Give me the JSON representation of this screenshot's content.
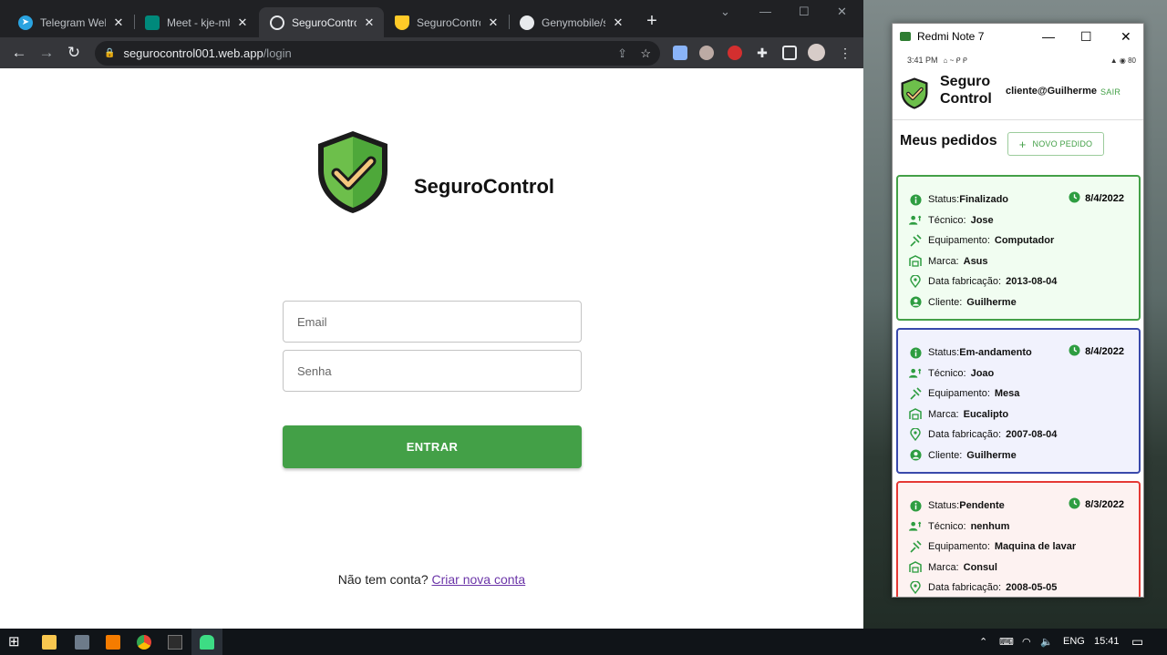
{
  "browser": {
    "tabs": [
      {
        "title": "Telegram Web",
        "icon": "telegram-icon",
        "color": "#2aa3e0"
      },
      {
        "title": "Meet - kje-mhc",
        "icon": "meet-icon",
        "color": "#00897b"
      },
      {
        "title": "SeguroControl",
        "icon": "globe-icon",
        "color": "#e8eaed"
      },
      {
        "title": "SeguroControl",
        "icon": "firebase-icon",
        "color": "#ffca28"
      },
      {
        "title": "Genymobile/sc",
        "icon": "github-icon",
        "color": "#e8eaed"
      }
    ],
    "url_host": "segurocontrol001.web.app",
    "url_path": "/login"
  },
  "login": {
    "brand": "SeguroControl",
    "email_placeholder": "Email",
    "password_placeholder": "Senha",
    "submit_label": "ENTRAR",
    "signup_prompt": "Não tem conta?",
    "signup_link": "Criar nova conta",
    "accent": "#43a047"
  },
  "emulator": {
    "window_title": "Redmi Note 7",
    "status_time": "3:41 PM",
    "status_battery": "80",
    "app_name_line1": "Seguro",
    "app_name_line2": "Control",
    "user": "cliente@Guilherme",
    "logout_label": "SAIR",
    "section_title": "Meus pedidos",
    "new_order_label": "NOVO PEDIDO",
    "orders": [
      {
        "status": "Finalizado",
        "date": "8/4/2022",
        "tecnico": "Jose",
        "equipamento": "Computador",
        "marca": "Asus",
        "data_fabricacao": "2013-08-04",
        "cliente": "Guilherme",
        "border": "#43a047",
        "bg": "#f1fdf1"
      },
      {
        "status": "Em-andamento",
        "date": "8/4/2022",
        "tecnico": "Joao",
        "equipamento": "Mesa",
        "marca": "Eucalipto",
        "data_fabricacao": "2007-08-04",
        "cliente": "Guilherme",
        "border": "#3949ab",
        "bg": "#f1f2fd"
      },
      {
        "status": "Pendente",
        "date": "8/3/2022",
        "tecnico": "nenhum",
        "equipamento": "Maquina de lavar",
        "marca": "Consul",
        "data_fabricacao": "2008-05-05",
        "cliente": "",
        "border": "#e53935",
        "bg": "#fdf2f1"
      }
    ],
    "labels": {
      "status": "Status:",
      "tecnico": "Técnico:",
      "equipamento": "Equipamento:",
      "marca": "Marca:",
      "data_fabricacao": "Data fabricação:",
      "cliente": "Cliente:"
    }
  },
  "taskbar": {
    "language": "ENG",
    "time": "15:41"
  }
}
